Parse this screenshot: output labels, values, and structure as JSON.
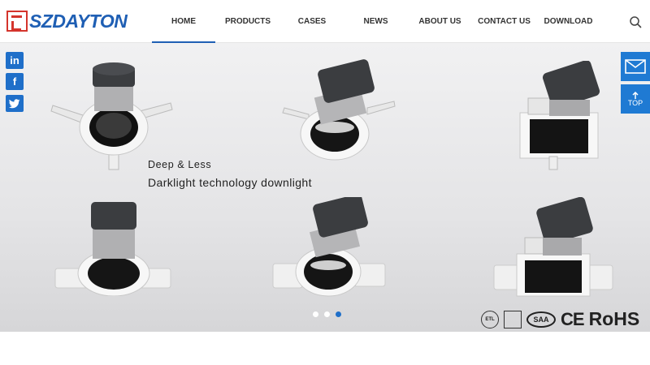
{
  "brand": {
    "name": "SZDAYTON"
  },
  "nav": [
    {
      "label": "HOME",
      "active": true
    },
    {
      "label": "PRODUCTS",
      "active": false
    },
    {
      "label": "CASES",
      "active": false
    },
    {
      "label": "NEWS",
      "active": false
    },
    {
      "label": "ABOUT US",
      "active": false
    },
    {
      "label": "CONTACT US",
      "active": false
    },
    {
      "label": "DOWNLOAD",
      "active": false
    }
  ],
  "social": [
    {
      "label": "in",
      "icon": "linkedin-icon"
    },
    {
      "label": "f",
      "icon": "facebook-icon"
    },
    {
      "label": "t",
      "icon": "twitter-icon"
    }
  ],
  "banner": {
    "tagline1": "Deep & Less",
    "tagline2": "Darklight technology downlight",
    "slide_count": 3,
    "active_slide": 3
  },
  "side": {
    "top_label": "TOP"
  },
  "certs": {
    "ce": "CE",
    "rohs": "RoHS",
    "saa": "SAA",
    "etl": "ETL",
    "energy": "ENERGY STAR"
  },
  "colors": {
    "accent": "#1f6fc9",
    "brand_blue": "#1f5fb4",
    "brand_red": "#d4342c"
  }
}
